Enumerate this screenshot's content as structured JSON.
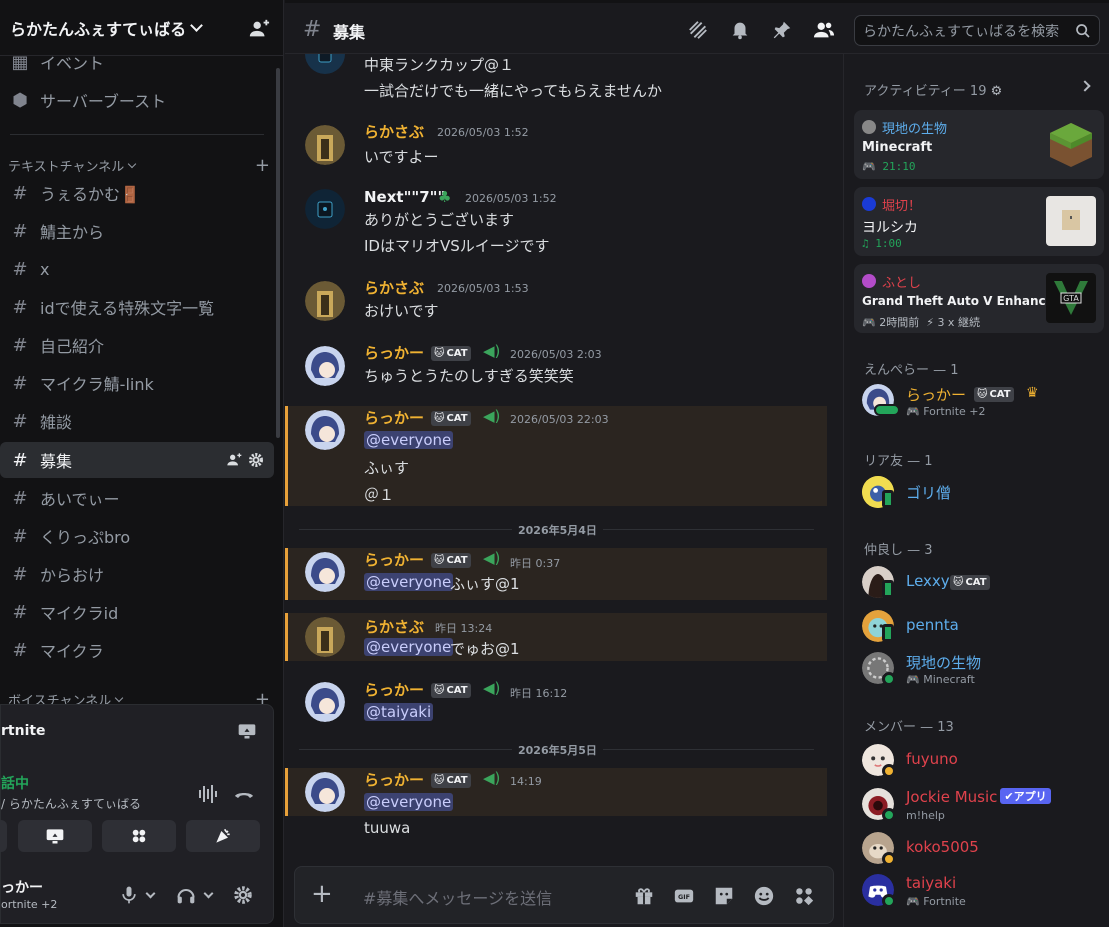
{
  "server": {
    "name": "らかたんふぇすてぃばる"
  },
  "sidebar": {
    "top_items": [
      {
        "label": "イベント",
        "icon": "calendar-icon"
      },
      {
        "label": "サーバーブースト",
        "icon": "boost-icon"
      }
    ],
    "text_category": "テキストチャンネル",
    "voice_category": "ボイスチャンネル",
    "channels": [
      {
        "label": "うぇるかむ🚪"
      },
      {
        "label": "鯖主から"
      },
      {
        "label": "x"
      },
      {
        "label": "idで使える特殊文字一覧"
      },
      {
        "label": "自己紹介"
      },
      {
        "label": "マイクラ鯖-link"
      },
      {
        "label": "雑談"
      },
      {
        "label": "募集"
      },
      {
        "label": "あいでぃー"
      },
      {
        "label": "くりっぷbro"
      },
      {
        "label": "からおけ"
      },
      {
        "label": "マイクラid"
      },
      {
        "label": "マイクラ"
      }
    ]
  },
  "voice_panel": {
    "activity": "rtnite",
    "status": "話中",
    "sub": "/ らかたんふぇすてぃばる",
    "user": "っかー",
    "user_status": "ortnite +2"
  },
  "topbar": {
    "channel": "募集",
    "search_placeholder": "らかたんふぇすてぃばるを検索"
  },
  "messages": {
    "m0_line1": "中東ランクカップ@１",
    "m0_line2": "一試合だけでも一緒にやってもらえませんか",
    "m1_user": "らかさぶ",
    "m1_ts": "2026/05/03 1:52",
    "m1_text": "いですよー",
    "m2_user": "Next\"\"7\"\"",
    "m2_ts": "2026/05/03 1:52",
    "m2_text1": "ありがとうございます",
    "m2_text2": "IDはマリオVSルイージです",
    "m3_user": "らかさぶ",
    "m3_ts": "2026/05/03 1:53",
    "m3_text": "おけいです",
    "m4_user": "らっかー",
    "m4_ts": "2026/05/03 2:03",
    "m4_text": "ちゅうとうたのしすぎる笑笑笑",
    "m5_user": "らっかー",
    "m5_ts": "2026/05/03 22:03",
    "m5_mention": "@everyone",
    "m5_text1": "ふぃす",
    "m5_text2": "＠１",
    "date1": "2026年5月4日",
    "m6_user": "らっかー",
    "m6_ts": "昨日 0:37",
    "m6_mention": "@everyone",
    "m6_text": "ふぃす@1",
    "m7_user": "らかさぶ",
    "m7_ts": "昨日 13:24",
    "m7_mention": "@everyone",
    "m7_text": "でゅお@1",
    "m8_user": "らっかー",
    "m8_ts": "昨日 16:12",
    "m8_mention": "@taiyaki",
    "date2": "2026年5月5日",
    "m9_user": "らっかー",
    "m9_ts": "14:19",
    "m9_mention": "@everyone",
    "m9_text": "tuuwa",
    "cat_badge": "CAT"
  },
  "composer": {
    "placeholder": "#募集へメッセージを送信"
  },
  "members": {
    "activity_header": "アクティビティー 19",
    "activities": [
      {
        "user": "現地の生物",
        "game": "Minecraft",
        "time": "21:10",
        "user_color": "#5dadec"
      },
      {
        "user": "堀切！",
        "game": "ヨルシカ",
        "time": "1:00",
        "user_color": "#e0424c"
      },
      {
        "user": "ふとし",
        "game": "Grand Theft Auto V Enhanc...",
        "time": "2時間前",
        "extra": "3 x 継続",
        "user_color": "#e0424c"
      }
    ],
    "groups": [
      {
        "label": "えんぺらー — 1"
      },
      {
        "label": "リア友 — 1"
      },
      {
        "label": "仲良し — 3"
      },
      {
        "label": "メンバー — 13"
      }
    ],
    "list": [
      {
        "name": "らっかー",
        "sub": "Fortnite +2",
        "color": "#f0b232"
      },
      {
        "name": "ゴリ僧",
        "sub": "",
        "color": "#5dadec"
      },
      {
        "name": "Lexxy",
        "sub": "",
        "color": "#5dadec"
      },
      {
        "name": "pennta",
        "sub": "",
        "color": "#5dadec"
      },
      {
        "name": "現地の生物",
        "sub": "Minecraft",
        "color": "#5dadec"
      },
      {
        "name": "fuyuno",
        "sub": "",
        "color": "#e0424c"
      },
      {
        "name": "Jockie Music",
        "sub": "m!help",
        "color": "#e0424c",
        "badge": "アプリ"
      },
      {
        "name": "koko5005",
        "sub": "",
        "color": "#e0424c"
      },
      {
        "name": "taiyaki",
        "sub": "Fortnite",
        "color": "#e0424c"
      }
    ]
  }
}
